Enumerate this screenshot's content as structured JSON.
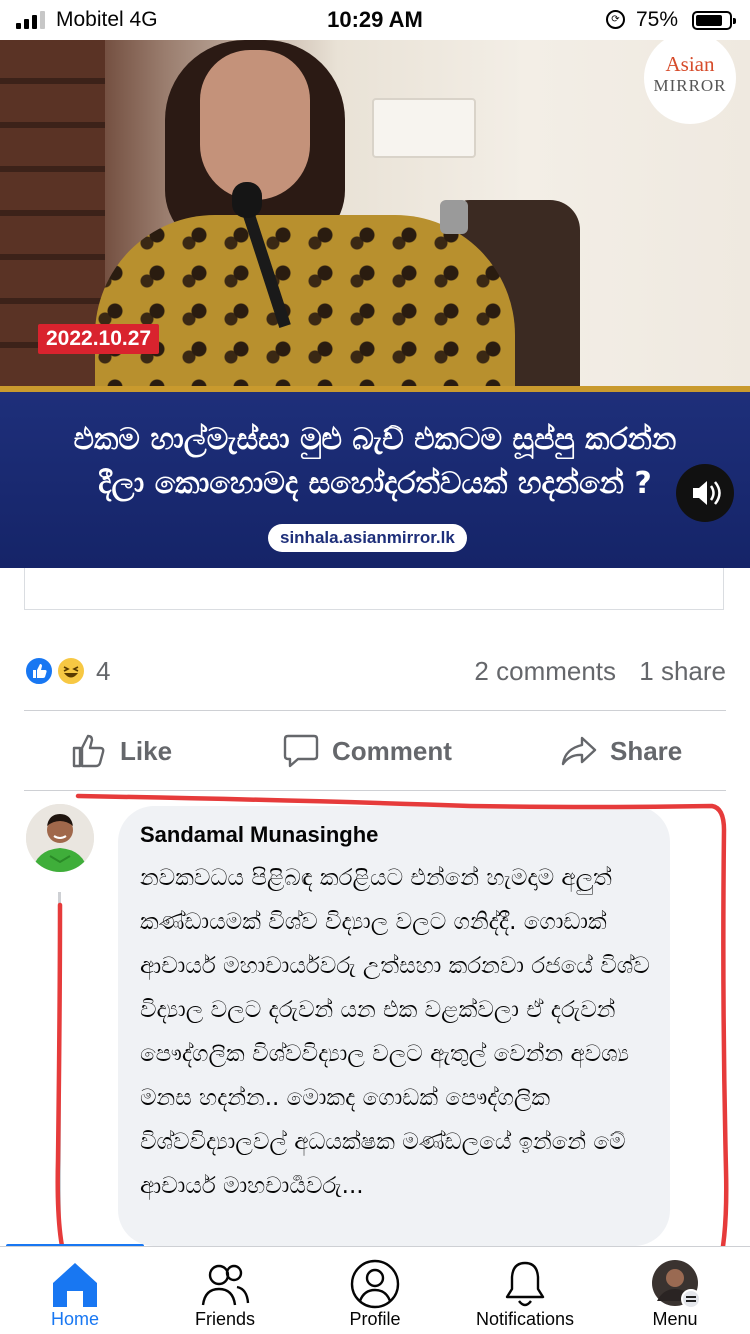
{
  "status_bar": {
    "carrier": "Mobitel  4G",
    "time": "10:29 AM",
    "battery": "75%",
    "battery_level": 0.75,
    "signal_bars": 3
  },
  "post": {
    "video": {
      "logo_top": "Asian",
      "logo_bottom": "MIRROR",
      "date_badge": "2022.10.27",
      "headline_line1": "එකම හාල්මැස්සා මුළු බැච් එකටම සූප්පු කරන්න",
      "headline_line2": "දීලා කොහොමද සහෝදරත්වයක් හදන්නේ ?",
      "url": "sinhala.asianmirror.lk",
      "sound_icon": "speaker-icon"
    },
    "reactions": {
      "count": "4",
      "types": [
        "like",
        "haha"
      ],
      "comments": "2 comments",
      "shares": "1 share"
    },
    "actions": {
      "like": "Like",
      "comment": "Comment",
      "share": "Share"
    }
  },
  "comment": {
    "author": "Sandamal Munasinghe",
    "text": "නවකවධය පිළිබඳ කරළියට එන්නේ හැමදාම අලුත් කණ්ඩායමක් විශ්ව විද්‍යාල වලට ගනිද්දී. ගොඩාක් ආචාර්ය මහාචාර්යවරු උත්සහා කරනවා රජයේ විශ්ව විද්‍යාල වලට දරුවන් යන එක වළක්වලා ඒ දරුවන් පෞද්ගලික විශ්වවිද්‍යාල වලට ඇතුල් වෙන්න අවශ්‍ය මනස හදන්න.. මොකද ගොඩක් පෞද්ගලික විශ්වවිද්‍යාලවල් අධයක්ෂක මණ්ඩලයේ ඉන්නේ මේ ආචාර්ය මාහචාර්‍යවරු..."
  },
  "tab_bar": {
    "tabs": [
      {
        "label": "Home",
        "icon": "home-icon",
        "active": true
      },
      {
        "label": "Friends",
        "icon": "friends-icon",
        "active": false
      },
      {
        "label": "Profile",
        "icon": "profile-icon",
        "active": false
      },
      {
        "label": "Notifications",
        "icon": "bell-icon",
        "active": false
      },
      {
        "label": "Menu",
        "icon": "menu-avatar-icon",
        "active": false
      }
    ]
  },
  "colors": {
    "facebook_blue": "#1877f2",
    "banner_blue": "#1e2f7a",
    "annotation_red": "#e63b3b",
    "badge_red": "#d9232e"
  }
}
